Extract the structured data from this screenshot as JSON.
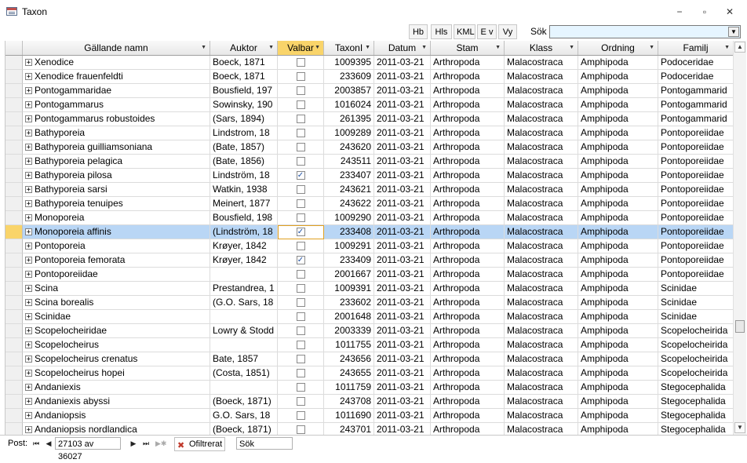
{
  "window": {
    "title": "Taxon",
    "minimize": "−",
    "restore": "▫",
    "close": "✕"
  },
  "toolbar": {
    "buttons": [
      {
        "label": "Hb",
        "left": 0
      },
      {
        "label": "Hls"
      },
      {
        "label": "KML"
      },
      {
        "label": "E v"
      },
      {
        "label": "Vy"
      }
    ],
    "search_label": "Sök",
    "search_value": ""
  },
  "columns": [
    "Gällande namn",
    "Auktor",
    "Valbar",
    "TaxonI",
    "Datum",
    "Stam",
    "Klass",
    "Ordning",
    "Familj"
  ],
  "rows": [
    {
      "name": "Xenodice",
      "auktor": "Boeck, 1871",
      "valbar": false,
      "taxon": "1009395",
      "datum": "2011-03-21",
      "stam": "Arthropoda",
      "klass": "Malacostraca",
      "ordning": "Amphipoda",
      "familj": "Podoceridae"
    },
    {
      "name": "Xenodice frauenfeldti",
      "auktor": "Boeck, 1871",
      "valbar": false,
      "taxon": "233609",
      "datum": "2011-03-21",
      "stam": "Arthropoda",
      "klass": "Malacostraca",
      "ordning": "Amphipoda",
      "familj": "Podoceridae"
    },
    {
      "name": "Pontogammaridae",
      "auktor": "Bousfield, 197",
      "valbar": false,
      "taxon": "2003857",
      "datum": "2011-03-21",
      "stam": "Arthropoda",
      "klass": "Malacostraca",
      "ordning": "Amphipoda",
      "familj": "Pontogammarid"
    },
    {
      "name": "Pontogammarus",
      "auktor": "Sowinsky, 190",
      "valbar": false,
      "taxon": "1016024",
      "datum": "2011-03-21",
      "stam": "Arthropoda",
      "klass": "Malacostraca",
      "ordning": "Amphipoda",
      "familj": "Pontogammarid"
    },
    {
      "name": "Pontogammarus robustoides",
      "auktor": "(Sars, 1894)",
      "valbar": false,
      "taxon": "261395",
      "datum": "2011-03-21",
      "stam": "Arthropoda",
      "klass": "Malacostraca",
      "ordning": "Amphipoda",
      "familj": "Pontogammarid"
    },
    {
      "name": "Bathyporeia",
      "auktor": "Lindstrom, 18",
      "valbar": false,
      "taxon": "1009289",
      "datum": "2011-03-21",
      "stam": "Arthropoda",
      "klass": "Malacostraca",
      "ordning": "Amphipoda",
      "familj": "Pontoporeiidae"
    },
    {
      "name": "Bathyporeia guilliamsoniana",
      "auktor": "(Bate, 1857)",
      "valbar": false,
      "taxon": "243620",
      "datum": "2011-03-21",
      "stam": "Arthropoda",
      "klass": "Malacostraca",
      "ordning": "Amphipoda",
      "familj": "Pontoporeiidae"
    },
    {
      "name": "Bathyporeia pelagica",
      "auktor": "(Bate, 1856)",
      "valbar": false,
      "taxon": "243511",
      "datum": "2011-03-21",
      "stam": "Arthropoda",
      "klass": "Malacostraca",
      "ordning": "Amphipoda",
      "familj": "Pontoporeiidae"
    },
    {
      "name": "Bathyporeia pilosa",
      "auktor": "Lindström, 18",
      "valbar": true,
      "taxon": "233407",
      "datum": "2011-03-21",
      "stam": "Arthropoda",
      "klass": "Malacostraca",
      "ordning": "Amphipoda",
      "familj": "Pontoporeiidae"
    },
    {
      "name": "Bathyporeia sarsi",
      "auktor": "Watkin, 1938",
      "valbar": false,
      "taxon": "243621",
      "datum": "2011-03-21",
      "stam": "Arthropoda",
      "klass": "Malacostraca",
      "ordning": "Amphipoda",
      "familj": "Pontoporeiidae"
    },
    {
      "name": "Bathyporeia tenuipes",
      "auktor": "Meinert, 1877",
      "valbar": false,
      "taxon": "243622",
      "datum": "2011-03-21",
      "stam": "Arthropoda",
      "klass": "Malacostraca",
      "ordning": "Amphipoda",
      "familj": "Pontoporeiidae"
    },
    {
      "name": "Monoporeia",
      "auktor": "Bousfield, 198",
      "valbar": false,
      "taxon": "1009290",
      "datum": "2011-03-21",
      "stam": "Arthropoda",
      "klass": "Malacostraca",
      "ordning": "Amphipoda",
      "familj": "Pontoporeiidae"
    },
    {
      "name": "Monoporeia affinis",
      "auktor": "(Lindström, 18",
      "valbar": true,
      "taxon": "233408",
      "datum": "2011-03-21",
      "stam": "Arthropoda",
      "klass": "Malacostraca",
      "ordning": "Amphipoda",
      "familj": "Pontoporeiidae",
      "selected": true
    },
    {
      "name": "Pontoporeia",
      "auktor": "Krøyer, 1842",
      "valbar": false,
      "taxon": "1009291",
      "datum": "2011-03-21",
      "stam": "Arthropoda",
      "klass": "Malacostraca",
      "ordning": "Amphipoda",
      "familj": "Pontoporeiidae"
    },
    {
      "name": "Pontoporeia femorata",
      "auktor": "Krøyer, 1842",
      "valbar": true,
      "taxon": "233409",
      "datum": "2011-03-21",
      "stam": "Arthropoda",
      "klass": "Malacostraca",
      "ordning": "Amphipoda",
      "familj": "Pontoporeiidae"
    },
    {
      "name": "Pontoporeiidae",
      "auktor": "",
      "valbar": false,
      "taxon": "2001667",
      "datum": "2011-03-21",
      "stam": "Arthropoda",
      "klass": "Malacostraca",
      "ordning": "Amphipoda",
      "familj": "Pontoporeiidae"
    },
    {
      "name": "Scina",
      "auktor": "Prestandrea, 1",
      "valbar": false,
      "taxon": "1009391",
      "datum": "2011-03-21",
      "stam": "Arthropoda",
      "klass": "Malacostraca",
      "ordning": "Amphipoda",
      "familj": "Scinidae"
    },
    {
      "name": "Scina borealis",
      "auktor": "(G.O. Sars, 18",
      "valbar": false,
      "taxon": "233602",
      "datum": "2011-03-21",
      "stam": "Arthropoda",
      "klass": "Malacostraca",
      "ordning": "Amphipoda",
      "familj": "Scinidae"
    },
    {
      "name": "Scinidae",
      "auktor": "",
      "valbar": false,
      "taxon": "2001648",
      "datum": "2011-03-21",
      "stam": "Arthropoda",
      "klass": "Malacostraca",
      "ordning": "Amphipoda",
      "familj": "Scinidae"
    },
    {
      "name": "Scopelocheiridae",
      "auktor": "Lowry & Stodd",
      "valbar": false,
      "taxon": "2003339",
      "datum": "2011-03-21",
      "stam": "Arthropoda",
      "klass": "Malacostraca",
      "ordning": "Amphipoda",
      "familj": "Scopelocheirida"
    },
    {
      "name": "Scopelocheirus",
      "auktor": "",
      "valbar": false,
      "taxon": "1011755",
      "datum": "2011-03-21",
      "stam": "Arthropoda",
      "klass": "Malacostraca",
      "ordning": "Amphipoda",
      "familj": "Scopelocheirida"
    },
    {
      "name": "Scopelocheirus crenatus",
      "auktor": "Bate, 1857",
      "valbar": false,
      "taxon": "243656",
      "datum": "2011-03-21",
      "stam": "Arthropoda",
      "klass": "Malacostraca",
      "ordning": "Amphipoda",
      "familj": "Scopelocheirida"
    },
    {
      "name": "Scopelocheirus hopei",
      "auktor": "(Costa, 1851)",
      "valbar": false,
      "taxon": "243655",
      "datum": "2011-03-21",
      "stam": "Arthropoda",
      "klass": "Malacostraca",
      "ordning": "Amphipoda",
      "familj": "Scopelocheirida"
    },
    {
      "name": "Andaniexis",
      "auktor": "",
      "valbar": false,
      "taxon": "1011759",
      "datum": "2011-03-21",
      "stam": "Arthropoda",
      "klass": "Malacostraca",
      "ordning": "Amphipoda",
      "familj": "Stegocephalida"
    },
    {
      "name": "Andaniexis abyssi",
      "auktor": "(Boeck, 1871)",
      "valbar": false,
      "taxon": "243708",
      "datum": "2011-03-21",
      "stam": "Arthropoda",
      "klass": "Malacostraca",
      "ordning": "Amphipoda",
      "familj": "Stegocephalida"
    },
    {
      "name": "Andaniopsis",
      "auktor": "G.O. Sars, 18",
      "valbar": false,
      "taxon": "1011690",
      "datum": "2011-03-21",
      "stam": "Arthropoda",
      "klass": "Malacostraca",
      "ordning": "Amphipoda",
      "familj": "Stegocephalida"
    },
    {
      "name": "Andaniopsis nordlandica",
      "auktor": "(Boeck, 1871)",
      "valbar": false,
      "taxon": "243701",
      "datum": "2011-03-21",
      "stam": "Arthropoda",
      "klass": "Malacostraca",
      "ordning": "Amphipoda",
      "familj": "Stegocephalida"
    }
  ],
  "statusbar": {
    "post_label": "Post:",
    "record": "27103 av 36027",
    "filter_label": "Ofiltrerat",
    "search_label": "Sök"
  },
  "colors": {
    "selected_row": "#b9d6f5",
    "selected_header": "#f9d46a",
    "search_bg": "#e6f5ff"
  }
}
